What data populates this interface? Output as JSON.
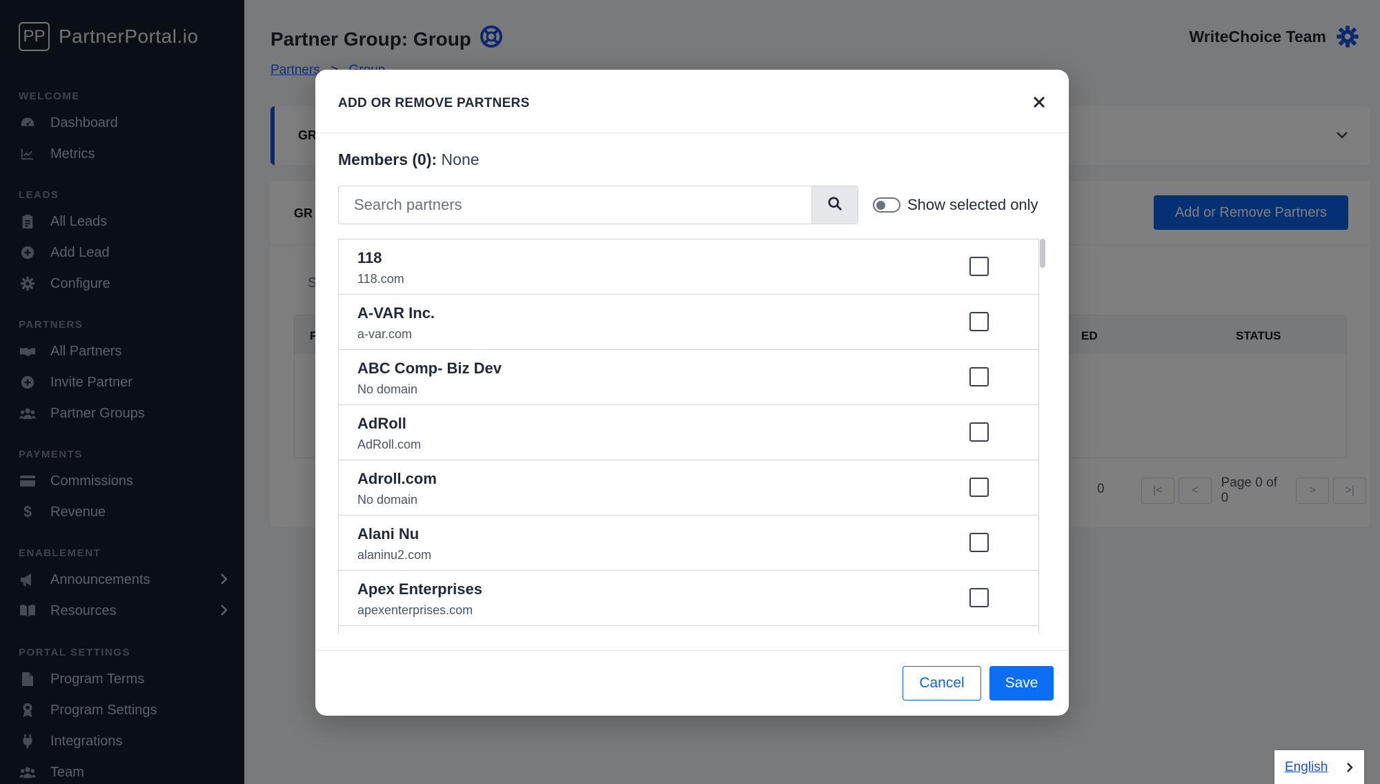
{
  "brand": {
    "mark": "PP",
    "name": "PartnerPortal.io"
  },
  "sidebar": {
    "sections": [
      {
        "title": "WELCOME",
        "items": [
          {
            "label": "Dashboard",
            "icon": "gauge-icon"
          },
          {
            "label": "Metrics",
            "icon": "chart-line-icon"
          }
        ]
      },
      {
        "title": "LEADS",
        "items": [
          {
            "label": "All Leads",
            "icon": "clipboard-icon"
          },
          {
            "label": "Add Lead",
            "icon": "plus-circle-icon"
          },
          {
            "label": "Configure",
            "icon": "gear-icon"
          }
        ]
      },
      {
        "title": "PARTNERS",
        "items": [
          {
            "label": "All Partners",
            "icon": "handshake-icon"
          },
          {
            "label": "Invite Partner",
            "icon": "plus-circle-icon"
          },
          {
            "label": "Partner Groups",
            "icon": "users-icon"
          }
        ]
      },
      {
        "title": "PAYMENTS",
        "items": [
          {
            "label": "Commissions",
            "icon": "credit-card-icon"
          },
          {
            "label": "Revenue",
            "icon": "dollar-icon"
          }
        ]
      },
      {
        "title": "ENABLEMENT",
        "items": [
          {
            "label": "Announcements",
            "icon": "megaphone-icon"
          },
          {
            "label": "Resources",
            "icon": "book-icon"
          }
        ]
      },
      {
        "title": "PORTAL SETTINGS",
        "items": [
          {
            "label": "Program Terms",
            "icon": "file-icon"
          },
          {
            "label": "Program Settings",
            "icon": "award-icon"
          },
          {
            "label": "Integrations",
            "icon": "plug-icon"
          },
          {
            "label": "Team",
            "icon": "users-icon"
          }
        ]
      }
    ]
  },
  "header": {
    "title": "Partner Group: Group",
    "team_name": "WriteChoice Team",
    "breadcrumb": {
      "root": "Partners",
      "separator": ">",
      "current": "Group"
    }
  },
  "background": {
    "card1_label": "GR",
    "card2_label": "GR",
    "add_remove_button": "Add or Remove Partners",
    "search_letter": "S",
    "table_first_col": "F",
    "table_col_ed": "ED",
    "table_col_status": "STATUS",
    "count": "0",
    "page_info": "Page 0 of 0"
  },
  "modal": {
    "title": "ADD OR REMOVE PARTNERS",
    "members_label": "Members (0):",
    "members_value": "None",
    "search_placeholder": "Search partners",
    "toggle_label": "Show selected only",
    "partners": [
      {
        "name": "118",
        "domain": "118.com"
      },
      {
        "name": "A-VAR Inc.",
        "domain": "a-var.com"
      },
      {
        "name": "ABC Comp- Biz Dev",
        "domain": "No domain"
      },
      {
        "name": "AdRoll",
        "domain": "AdRoll.com"
      },
      {
        "name": "Adroll.com",
        "domain": "No domain"
      },
      {
        "name": "Alani Nu",
        "domain": "alaninu2.com"
      },
      {
        "name": "Apex Enterprises",
        "domain": "apexenterprises.com"
      }
    ],
    "cancel_label": "Cancel",
    "save_label": "Save"
  },
  "language": {
    "label": "English"
  },
  "colors": {
    "sidebar_bg": "#141c2b",
    "primary": "#0b63e5",
    "accent_border": "#1d4ed8"
  }
}
